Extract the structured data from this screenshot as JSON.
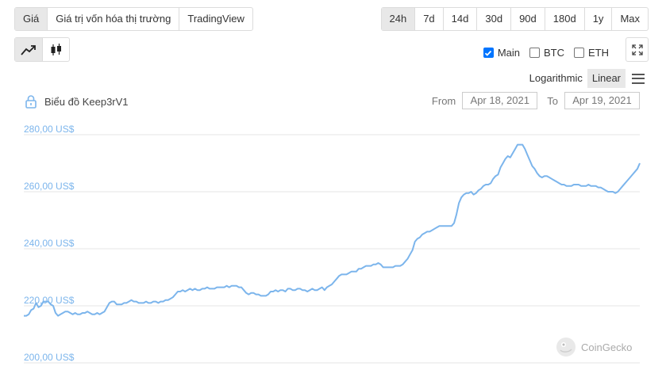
{
  "tabs": [
    {
      "label": "Giá",
      "active": true
    },
    {
      "label": "Giá trị vốn hóa thị trường",
      "active": false
    },
    {
      "label": "TradingView",
      "active": false
    }
  ],
  "ranges": [
    {
      "label": "24h",
      "active": true
    },
    {
      "label": "7d",
      "active": false
    },
    {
      "label": "14d",
      "active": false
    },
    {
      "label": "30d",
      "active": false
    },
    {
      "label": "90d",
      "active": false
    },
    {
      "label": "180d",
      "active": false
    },
    {
      "label": "1y",
      "active": false
    },
    {
      "label": "Max",
      "active": false
    }
  ],
  "chart_type_buttons": [
    {
      "icon": "line-chart-icon",
      "active": true
    },
    {
      "icon": "candlestick-icon",
      "active": false
    }
  ],
  "series_toggles": [
    {
      "label": "Main",
      "checked": true
    },
    {
      "label": "BTC",
      "checked": false
    },
    {
      "label": "ETH",
      "checked": false
    }
  ],
  "scale": {
    "logarithmic": "Logarithmic",
    "linear": "Linear",
    "active": "linear"
  },
  "chart_title": "Biểu đồ Keep3rV1",
  "date_range": {
    "from_label": "From",
    "from": "Apr 18, 2021",
    "to_label": "To",
    "to": "Apr 19, 2021"
  },
  "watermark": "CoinGecko",
  "colors": {
    "line": "#7cb5ec",
    "grid": "#e6e6e6",
    "active_bg": "#e8e8e8",
    "checkbox": "#0075ff"
  },
  "chart_data": {
    "type": "line",
    "title": "Biểu đồ Keep3rV1",
    "xlabel": "",
    "ylabel": "",
    "ylim": [
      200,
      280
    ],
    "y_ticks": [
      {
        "value": 200,
        "label": "200,00 US$"
      },
      {
        "value": 220,
        "label": "220,00 US$"
      },
      {
        "value": 240,
        "label": "240,00 US$"
      },
      {
        "value": 260,
        "label": "260,00 US$"
      },
      {
        "value": 280,
        "label": "280,00 US$"
      }
    ],
    "grid": true,
    "legend": "none",
    "series": [
      {
        "values": [
          216.5,
          216.5,
          217,
          218.5,
          219,
          221,
          219.5,
          220,
          221.5,
          221.5,
          221.5,
          220.5,
          220,
          217.5,
          216.5,
          217,
          217.5,
          218,
          218,
          217.5,
          217,
          217.5,
          217,
          217,
          217.5,
          217.5,
          218,
          217.5,
          217,
          217,
          217.5,
          217,
          217.5,
          218,
          219.5,
          221,
          221.5,
          221.5,
          220.5,
          220.5,
          220.5,
          221,
          221,
          221.5,
          222,
          221.5,
          221.5,
          221,
          221,
          221,
          221.5,
          221,
          221,
          221.5,
          221.5,
          221,
          221.5,
          221.5,
          222,
          222,
          222.5,
          223,
          224,
          225,
          225,
          225.5,
          225,
          225.5,
          226,
          225.5,
          226,
          225.5,
          225.5,
          226,
          226,
          226.5,
          226,
          226,
          226,
          226.5,
          226.5,
          226.5,
          226.5,
          227,
          226.5,
          227,
          227,
          227,
          226.5,
          226.5,
          225.5,
          224.5,
          224,
          224.5,
          224.5,
          224,
          224,
          223.5,
          223.5,
          223.5,
          224,
          225,
          225,
          225.5,
          225,
          225.5,
          225.5,
          225,
          226,
          226,
          225.5,
          225.5,
          226,
          226,
          225.5,
          225.5,
          225,
          225.5,
          226,
          225.5,
          225.5,
          226,
          226.5,
          225.5,
          226.5,
          227,
          227.5,
          228.5,
          229.5,
          230.5,
          231,
          231,
          231,
          231.5,
          232,
          232,
          232,
          233,
          233,
          233.5,
          234,
          234,
          234,
          234.5,
          234.5,
          235,
          234.5,
          233.5,
          233.5,
          233.5,
          233.5,
          233.5,
          234,
          234,
          234,
          234.5,
          235.5,
          236.5,
          238,
          239.5,
          242.5,
          243.5,
          244,
          245,
          245.5,
          246,
          246,
          246.5,
          247,
          247.5,
          248,
          248,
          248,
          248,
          248,
          248,
          249,
          252,
          256,
          258,
          259,
          259.5,
          259.5,
          260,
          259,
          259.5,
          260.5,
          261,
          262,
          262.5,
          262.5,
          263,
          264.5,
          265.5,
          266,
          268.5,
          270,
          271.5,
          272.5,
          272,
          273.5,
          275,
          276.5,
          276.5,
          276.5,
          275,
          273,
          271,
          269,
          268,
          266.5,
          265.5,
          265,
          265.5,
          265.5,
          265,
          264.5,
          264,
          263.5,
          263,
          262.5,
          262.5,
          262,
          262,
          262,
          262.5,
          262.5,
          262.5,
          262,
          262,
          262,
          262.5,
          262,
          262,
          262,
          261.5,
          261.5,
          261,
          260.5,
          260,
          260,
          260,
          259.5,
          260,
          261,
          262,
          263,
          264,
          265,
          266,
          267,
          268,
          270
        ]
      }
    ]
  }
}
